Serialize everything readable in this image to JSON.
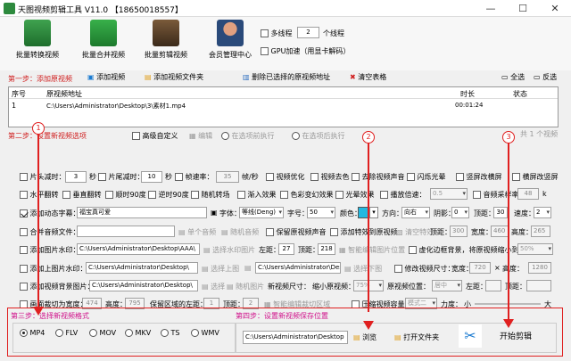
{
  "app": {
    "title": "天图视频剪辑工具 V11.0 【18650018557】"
  },
  "toolbar": {
    "tools": [
      {
        "label": "批量转换视频"
      },
      {
        "label": "批量合并视频"
      },
      {
        "label": "批量剪辑视频"
      },
      {
        "label": "会员管理中心"
      }
    ],
    "multithread_label": "多线程",
    "thread_count": "2",
    "thread_unit": "个线程",
    "gpu_label": "GPU加速（用显卡解码）"
  },
  "step1": {
    "title": "第一步：添加原视频",
    "add_video": "添加视频",
    "add_folder": "添加视频文件夹",
    "delete_selected": "删除已选择的原视频地址",
    "clear_table": "清空表格",
    "select_all": "全选",
    "invert": "反选"
  },
  "table": {
    "headers": [
      "序号",
      "原视频地址",
      "时长",
      "状态"
    ],
    "rows": [
      {
        "idx": "1",
        "path": "C:\\Users\\Administrator\\Desktop\\3\\素材1.mp4",
        "duration": "00:01:24",
        "status": ""
      }
    ]
  },
  "step2": {
    "title": "第二步：设置新视频选项",
    "advanced": "高级自定义",
    "edit": "编辑",
    "before_exec": "在选项前执行",
    "after_exec": "在选项后执行",
    "count": "共 1 个视频",
    "row1": {
      "head_cut": "片头减时：",
      "head_val": "3",
      "sec1": "秒",
      "tail_cut": "片尾减时：",
      "tail_val": "10",
      "sec2": "秒",
      "fps_label": "帧速率：",
      "fps_val": "35",
      "fps_unit": "帧/秒",
      "opt": "视频优化",
      "decolor": "视频去色",
      "remove_audio": "去除视频声音",
      "flash": "闪烁光晕",
      "vertical": "竖屏改横屏",
      "horizontal": "横屏改竖屏"
    },
    "row2": {
      "hflip": "水平翻转",
      "vflip": "垂直翻转",
      "cw90": "顺时90度",
      "ccw90": "逆时90度",
      "rand_scene": "随机转场",
      "fade": "渐入效果",
      "color_fx": "色彩变幻效果",
      "light": "光晕效果",
      "speed_label": "播放倍速：",
      "speed_val": "0.5",
      "sample_label": "音频采样率：",
      "sample_val": "48",
      "sample_unit": "k"
    },
    "row3": {
      "subtitle": "添加动态字幕：",
      "subtitle_val": "福宝真可爱",
      "font_label": "字体：",
      "font_val": "等线(Deng)",
      "size_label": "字号：",
      "size_val": "50",
      "color_label": "颜色：",
      "dir_label": "方向：",
      "dir_val": "向右",
      "shadow_label": "阴影：",
      "shadow_val": "0",
      "top_label": "顶距：",
      "top_val": "30",
      "speed_label": "速度：",
      "speed_val": "2"
    },
    "row4": {
      "merge_audio": "合并音频文件：",
      "single_audio": "单个音频",
      "random_audio": "随机音频",
      "keep_audio": "保留原视频声音",
      "add_fx": "添加特效到原视频",
      "clear_fx": "清空特效"
    },
    "row5": {
      "watermark": "添加图片水印：",
      "wm_path": "C:\\Users\\Administrator\\Desktop\\AAA\\",
      "select_wm": "选择水印图片",
      "left": "左距：",
      "left_val": "27",
      "top": "顶距：",
      "top_val": "218",
      "smart_pos": "智能编辑图片位置",
      "blur": "虚化边框背景，将原视频缩小到：",
      "blur_val": "50%"
    },
    "row6": {
      "top_img": "添加上图片水印：",
      "top_path": "C:\\Users\\Administrator\\Desktop\\",
      "select_top": "选择上图",
      "bottom_img": "选择下图",
      "bottom_path": "C:\\Users\\Administrator\\Desk",
      "resize": "修改视频尺寸：",
      "width_label": "宽度：",
      "width_val": "720",
      "x": "×",
      "height_label": "高度：",
      "height_val": "1280"
    },
    "row7": {
      "bg": "添加视频背景图片：",
      "bg_path": "C:\\Users\\Administrator\\Desktop\\",
      "select_bg": "选择",
      "random_bg": "随机图片",
      "new_size": "新视频尺寸：",
      "shrink": "缩小原视频：",
      "shrink_val": "75%",
      "pos": "原视频位置：",
      "pos_val": "居中",
      "left": "左距：",
      "top": "顶距："
    },
    "row8": {
      "crop": "画面裁切为宽度：",
      "crop_w": "474",
      "height": "高度：",
      "crop_h": "795",
      "keep_left": "保留区域的左距：",
      "left_val": "1",
      "top": "顶距：",
      "top_val": "2",
      "smart_crop": "智能编辑裁切区域",
      "compress": "压缩视频容量",
      "mode_val": "模式二",
      "size_label": "力度：",
      "small": "小",
      "big": "大"
    },
    "row4b": {
      "top_label": "顶距：",
      "top_val": "300",
      "width_label": "宽度：",
      "width_val": "460",
      "height_label": "高度：",
      "height_val": "265",
      "sel_label": "选择"
    }
  },
  "step3": {
    "title": "第三步：选择新视频格式",
    "formats": [
      {
        "label": "MP4",
        "selected": true
      },
      {
        "label": "FLV",
        "selected": false
      },
      {
        "label": "MOV",
        "selected": false
      },
      {
        "label": "MKV",
        "selected": false
      },
      {
        "label": "TS",
        "selected": false
      },
      {
        "label": "WMV",
        "selected": false
      }
    ]
  },
  "step4": {
    "title": "第四步：设置新视频保存位置",
    "path": "C:\\Users\\Administrator\\Desktop",
    "browse": "浏览",
    "open_folder": "打开文件夹",
    "start": "开始剪辑"
  },
  "markers": {
    "m1": "1",
    "m2": "2",
    "m3": "3"
  },
  "colors": {
    "highlight": "#e02020",
    "accent": "#d0108a"
  }
}
